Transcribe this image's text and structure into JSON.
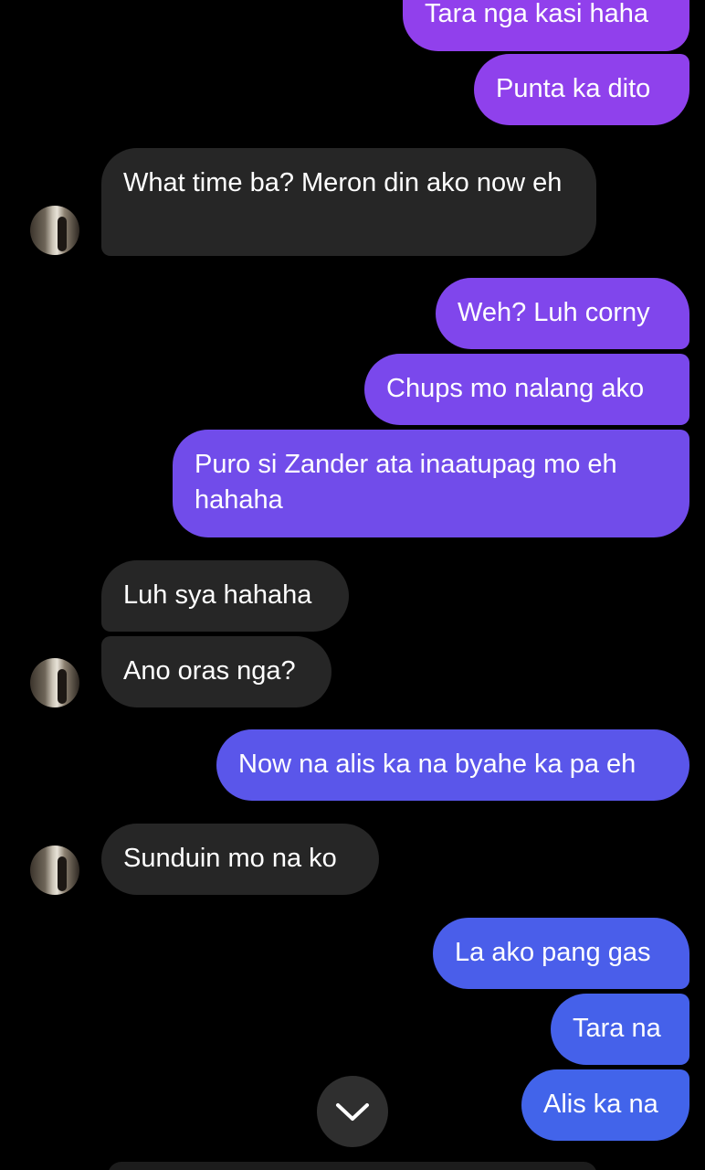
{
  "messages": [
    {
      "side": "out",
      "text": "Tara nga kasi haha",
      "color": "#9140ec"
    },
    {
      "side": "out",
      "text": "Punta ka dito",
      "color": "#8f41ec"
    },
    {
      "side": "in",
      "text": "What time ba? Meron din ako now eh"
    },
    {
      "side": "out",
      "text": "Weh? Luh corny",
      "color": "#8046ec"
    },
    {
      "side": "out",
      "text": "Chups mo nalang ako",
      "color": "#7a48ec"
    },
    {
      "side": "out",
      "text": "Puro si Zander ata inaatupag mo eh hahaha",
      "color": "#714cea"
    },
    {
      "side": "in",
      "text": "Luh sya hahaha"
    },
    {
      "side": "in",
      "text": "Ano oras nga?"
    },
    {
      "side": "out",
      "text": "Now na alis ka na byahe ka pa eh",
      "color": "#5a56ea"
    },
    {
      "side": "in",
      "text": "Sunduin mo na ko"
    },
    {
      "side": "out",
      "text": "La ako pang gas",
      "color": "#4a5eea"
    },
    {
      "side": "out",
      "text": "Tara na",
      "color": "#4561ea"
    },
    {
      "side": "out",
      "text": "Alis ka na",
      "color": "#4264ea"
    }
  ],
  "scroll_button": {
    "icon": "chevron-down-icon"
  },
  "avatar": {
    "icon": "contact-avatar"
  }
}
